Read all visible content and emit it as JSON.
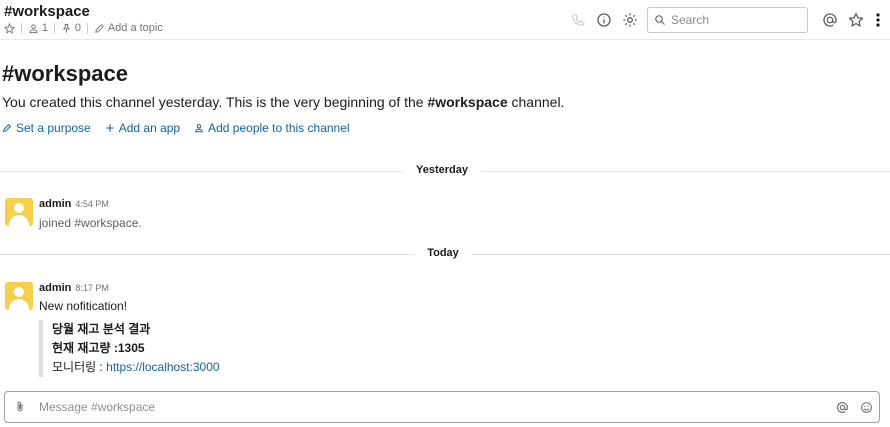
{
  "header": {
    "channel_title": "#workspace",
    "member_count": "1",
    "pinned_count": "0",
    "add_topic_label": "Add a topic",
    "search_placeholder": "Search"
  },
  "intro": {
    "title": "#workspace",
    "text_prefix": "You created this channel yesterday. This is the very beginning of the ",
    "channel_name": "#workspace",
    "text_suffix": " channel.",
    "actions": {
      "set_purpose": "Set a purpose",
      "add_app": "Add an app",
      "add_people": "Add people to this channel"
    }
  },
  "dividers": {
    "yesterday": "Yesterday",
    "today": "Today"
  },
  "messages": [
    {
      "author": "admin",
      "time": "4:54 PM",
      "text": "joined #workspace."
    },
    {
      "author": "admin",
      "time": "8:17 PM",
      "text": "New nofitication!",
      "attachment": {
        "line1": "당월 재고 분석 결과",
        "line2": "현재 재고량 :1305",
        "line3_label": "모니터링 : ",
        "line3_link": "https://localhost:3000"
      }
    }
  ],
  "composer": {
    "placeholder": "Message #workspace"
  },
  "colors": {
    "link": "#1264a3",
    "avatar": "#f5d04c",
    "attachment_border": "#dddddd"
  },
  "icons": [
    "star-outline-icon",
    "person-icon",
    "pin-icon",
    "pencil-icon",
    "phone-icon",
    "info-icon",
    "gear-icon",
    "search-icon",
    "at-sign-icon",
    "star-icon",
    "kebab-menu-icon",
    "paperclip-icon",
    "smiley-icon",
    "plus-icon"
  ]
}
